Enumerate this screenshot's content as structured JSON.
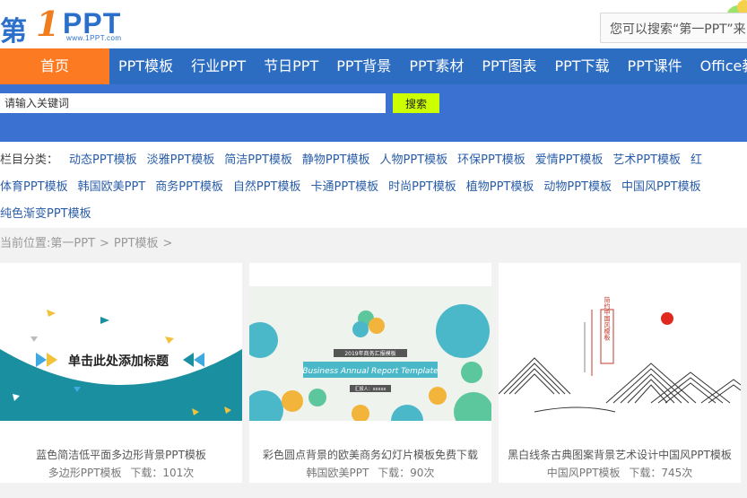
{
  "logo": {
    "cn": "第",
    "one": "1",
    "ppt": "PPT",
    "domain": "www.1PPT.com"
  },
  "top_search": {
    "text": "您可以搜索“第一PPT”来"
  },
  "nav": {
    "home": "首页",
    "items": [
      "PPT模板",
      "行业PPT",
      "节日PPT",
      "PPT背景",
      "PPT素材",
      "PPT图表",
      "PPT下载",
      "PPT课件",
      "Office教程"
    ]
  },
  "search": {
    "placeholder": "请输入关键词",
    "button": "搜索"
  },
  "categories": {
    "label": "栏目分类：",
    "row1": [
      "动态PPT模板",
      "淡雅PPT模板",
      "简洁PPT模板",
      "静物PPT模板",
      "人物PPT模板",
      "环保PPT模板",
      "爱情PPT模板",
      "艺术PPT模板",
      "红"
    ],
    "row2": [
      "体育PPT模板",
      "韩国欧美PPT",
      "商务PPT模板",
      "自然PPT模板",
      "卡通PPT模板",
      "时尚PPT模板",
      "植物PPT模板",
      "动物PPT模板",
      "中国风PPT模板"
    ],
    "row3": [
      "纯色渐变PPT模板"
    ]
  },
  "breadcrumb": {
    "prefix": "当前位置:",
    "home": "第一PPT",
    "sep": ">",
    "section": "PPT模板",
    "sep2": ">"
  },
  "cards": [
    {
      "title": "蓝色简洁低平面多边形背景PPT模板",
      "category": "多边形PPT模板",
      "downloads": "下载：101次",
      "thumb_text": "单击此处添加标题"
    },
    {
      "title": "彩色圆点背景的欧美商务幻灯片模板免费下载",
      "category": "韩国欧美PPT",
      "downloads": "下载：90次",
      "thumb_text": "Business Annual Report Template",
      "thumb_small": "2019年商务汇报模板",
      "thumb_name": "汇报人：xxxxx"
    },
    {
      "title": "黑白线条古典图案背景艺术设计中国风PPT模板",
      "category": "中国风PPT模板",
      "downloads": "下载：745次",
      "thumb_text": "简约中国风模板"
    }
  ],
  "colors": {
    "nav_blue": "#2c6dc2",
    "home_orange": "#fb7a22",
    "band_blue": "#3b71d0",
    "search_btn": "#ccff00",
    "link": "#2a5da8"
  }
}
